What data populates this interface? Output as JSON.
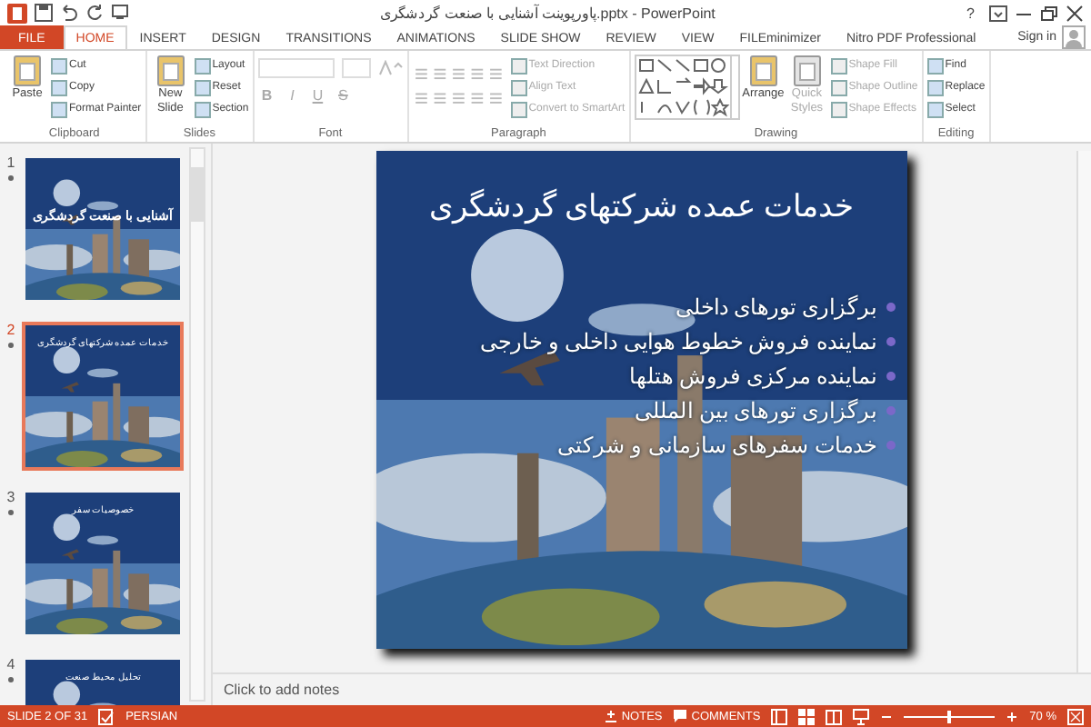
{
  "window": {
    "title": "پاورپوینت آشنایی با صنعت گردشگری.pptx - PowerPoint",
    "help": "?",
    "sign_in": "Sign in"
  },
  "tabs": [
    {
      "label": "FILE",
      "kind": "file",
      "selected": false
    },
    {
      "label": "HOME",
      "kind": "tab",
      "selected": true
    },
    {
      "label": "INSERT",
      "kind": "tab",
      "selected": false
    },
    {
      "label": "DESIGN",
      "kind": "tab",
      "selected": false
    },
    {
      "label": "TRANSITIONS",
      "kind": "tab",
      "selected": false
    },
    {
      "label": "ANIMATIONS",
      "kind": "tab",
      "selected": false
    },
    {
      "label": "SLIDE SHOW",
      "kind": "tab",
      "selected": false
    },
    {
      "label": "REVIEW",
      "kind": "tab",
      "selected": false
    },
    {
      "label": "VIEW",
      "kind": "tab",
      "selected": false
    },
    {
      "label": "FILEminimizer",
      "kind": "tab",
      "selected": false
    },
    {
      "label": "Nitro PDF Professional",
      "kind": "tab",
      "selected": false
    }
  ],
  "ribbon": [
    {
      "label": "Clipboard",
      "kind": "tools",
      "items": [
        {
          "kind": "large",
          "label": "Paste",
          "disabled": false
        },
        {
          "kind": "small",
          "label": "Cut",
          "disabled": false
        },
        {
          "kind": "small",
          "label": "Copy",
          "disabled": false
        },
        {
          "kind": "small",
          "label": "Format Painter",
          "disabled": false
        }
      ]
    },
    {
      "label": "Slides",
      "kind": "tools",
      "items": [
        {
          "kind": "large",
          "label": "New Slide",
          "disabled": false
        },
        {
          "kind": "small",
          "label": "Layout",
          "disabled": false
        },
        {
          "kind": "small",
          "label": "Reset",
          "disabled": false
        },
        {
          "kind": "small",
          "label": "Section",
          "disabled": false
        }
      ]
    },
    {
      "label": "Font",
      "kind": "font",
      "buttons": [
        "B",
        "I",
        "U",
        "S"
      ]
    },
    {
      "label": "Paragraph",
      "kind": "paragraph",
      "items": [
        {
          "kind": "small",
          "label": "Text Direction",
          "disabled": true
        },
        {
          "kind": "small",
          "label": "Align Text",
          "disabled": true
        },
        {
          "kind": "small",
          "label": "Convert to SmartArt",
          "disabled": true
        }
      ]
    },
    {
      "label": "Drawing",
      "kind": "drawing",
      "items": [
        {
          "kind": "large",
          "label": "Arrange",
          "disabled": false
        },
        {
          "kind": "large",
          "label": "Quick Styles",
          "disabled": true
        },
        {
          "kind": "small",
          "label": "Shape Fill",
          "disabled": true
        },
        {
          "kind": "small",
          "label": "Shape Outline",
          "disabled": true
        },
        {
          "kind": "small",
          "label": "Shape Effects",
          "disabled": true
        }
      ]
    },
    {
      "label": "Editing",
      "kind": "tools",
      "items": [
        {
          "kind": "small",
          "label": "Find",
          "disabled": false
        },
        {
          "kind": "small",
          "label": "Replace",
          "disabled": false
        },
        {
          "kind": "small",
          "label": "Select",
          "disabled": false
        }
      ]
    }
  ],
  "thumbnails": [
    {
      "number": "1",
      "title": "آشنایی با صنعت گردشگری",
      "selected": false
    },
    {
      "number": "2",
      "title": "خدمات عمده شرکتهای گردشگری",
      "selected": true
    },
    {
      "number": "3",
      "title": "خصوصیات سفر",
      "selected": false
    },
    {
      "number": "4",
      "title": "تحلیل محیط صنعت",
      "selected": false
    }
  ],
  "slide": {
    "title": "خدمات عمده شرکتهای گردشگری",
    "bullets": [
      "برگزاری تورهای داخلی",
      "نماینده فروش خطوط هوایی داخلی و خارجی",
      "نماینده مرکزی فروش هتلها",
      "برگزاری تورهای بین المللی",
      "خدمات سفرهای سازمانی و شرکتی"
    ]
  },
  "notes": {
    "placeholder": "Click to add notes"
  },
  "status_bar": {
    "slide": "SLIDE 2 OF 31",
    "language": "PERSIAN",
    "notes": "NOTES",
    "comments": "COMMENTS",
    "zoom": "70 %",
    "zoom_level": {
      "level": 0.5
    }
  }
}
